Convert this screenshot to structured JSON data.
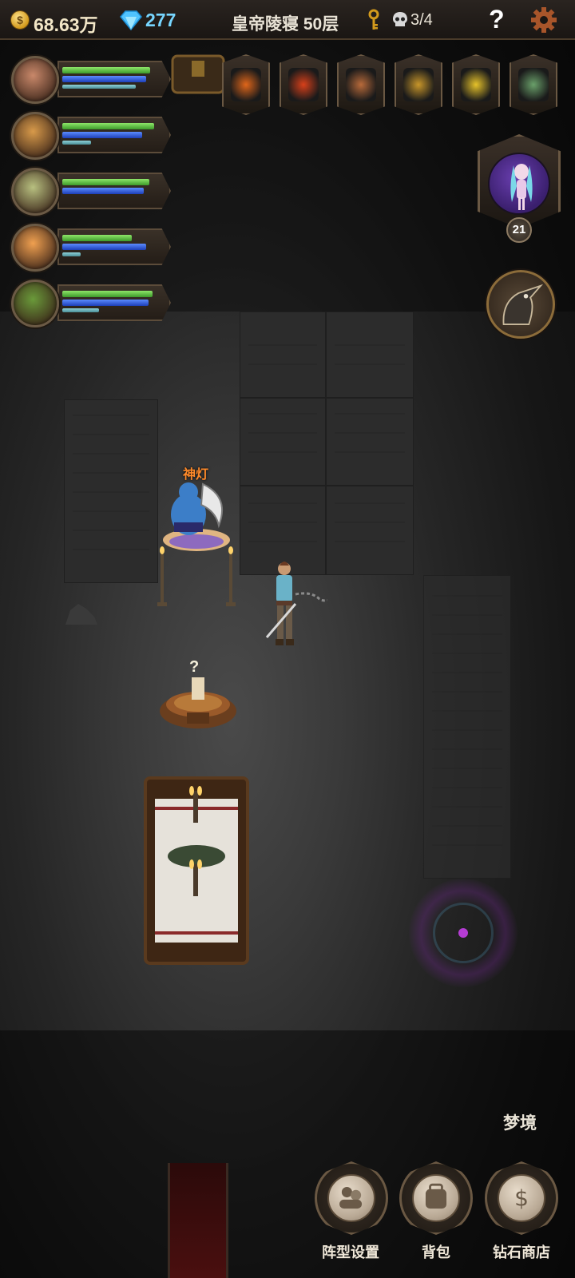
{
  "topbar": {
    "coin_symbol": "$",
    "gold": "68.63万",
    "gems": "277",
    "floor_title": "皇帝陵寝 50层",
    "skull_count": "3/4",
    "help_symbol": "?"
  },
  "party": [
    {
      "name": "hero-1",
      "hp": 0.86,
      "mp": 0.82,
      "xp": 0.72,
      "portrait_color": "#c9886a"
    },
    {
      "name": "hero-2",
      "hp": 0.9,
      "mp": 0.78,
      "xp": 0.28,
      "portrait_color": "#d89a4a"
    },
    {
      "name": "hero-3",
      "hp": 0.85,
      "mp": 0.8,
      "xp": 0.0,
      "portrait_color": "#b8c080"
    },
    {
      "name": "hero-4",
      "hp": 0.68,
      "mp": 0.82,
      "xp": 0.18,
      "portrait_color": "#f0a050"
    },
    {
      "name": "hero-5",
      "hp": 0.88,
      "mp": 0.84,
      "xp": 0.36,
      "portrait_color": "#6a9a3a"
    }
  ],
  "relics": [
    {
      "icon": "pumpkin-icon",
      "color": "#e0661a"
    },
    {
      "icon": "phoenix-icon",
      "color": "#d8401a"
    },
    {
      "icon": "horn-icon",
      "color": "#b86a3a"
    },
    {
      "icon": "bell-icon",
      "color": "#c8962a"
    },
    {
      "icon": "feather-icon",
      "color": "#e6c22a"
    },
    {
      "icon": "flute-icon",
      "color": "#6aa06a"
    }
  ],
  "companion": {
    "level": "21"
  },
  "npc": {
    "label": "神灯"
  },
  "chest": {
    "hint": "?"
  },
  "bottom_menu": {
    "dream_label": "梦境",
    "formation_label": "阵型设置",
    "backpack_label": "背包",
    "shop_label": "钻石商店"
  },
  "colors": {
    "accent_gold": "#d39a1c",
    "gem_blue": "#77d6ff",
    "npc_orange": "#ff8a2a",
    "joystick_purple": "#b53cd4"
  }
}
